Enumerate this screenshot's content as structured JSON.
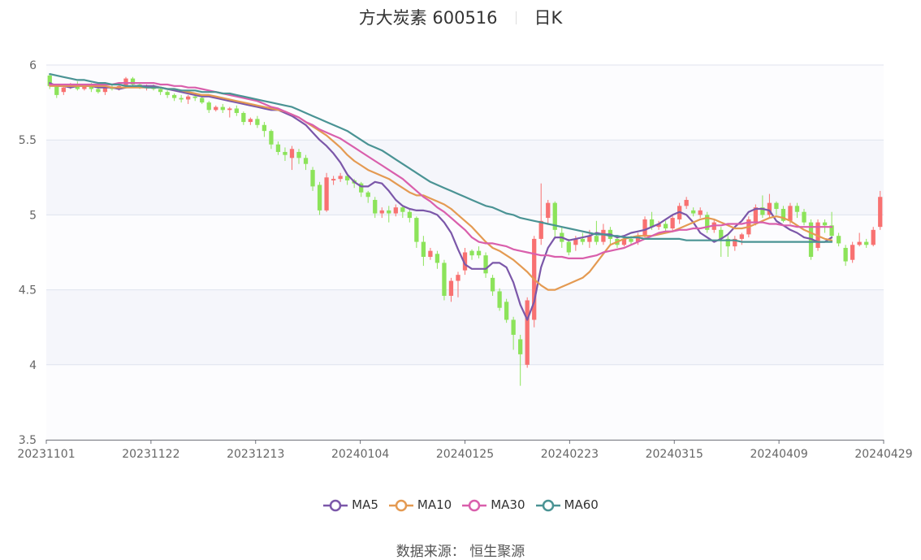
{
  "header": {
    "title": "方大炭素 600516",
    "period": "日K"
  },
  "source_label": "数据来源： 恒生聚源",
  "colors": {
    "up": "#f87171",
    "down": "#8ce35a",
    "grid": "#dfe3ee",
    "band": "#f5f6fb",
    "MA5": "#7b57a9",
    "MA10": "#e49a52",
    "MA30": "#d95fac",
    "MA60": "#4a9394"
  },
  "chart_data": {
    "type": "candlestick",
    "title": "方大炭素 600516",
    "ylim": [
      3.5,
      6
    ],
    "y_ticks": [
      "3.5",
      "4",
      "4.5",
      "5",
      "5.5",
      "6"
    ],
    "x_ticks": [
      "20231101",
      "20231122",
      "20231213",
      "20240104",
      "20240125",
      "20240223",
      "20240315",
      "20240409",
      "20240429"
    ],
    "series": [
      {
        "name": "MA5",
        "values": [
          5.88,
          5.86,
          5.86,
          5.85,
          5.86,
          5.86,
          5.86,
          5.85,
          5.85,
          5.85,
          5.84,
          5.85,
          5.86,
          5.86,
          5.86,
          5.86,
          5.85,
          5.84,
          5.83,
          5.82,
          5.81,
          5.8,
          5.79,
          5.79,
          5.78,
          5.77,
          5.76,
          5.75,
          5.74,
          5.73,
          5.72,
          5.71,
          5.7,
          5.7,
          5.68,
          5.66,
          5.63,
          5.6,
          5.55,
          5.5,
          5.46,
          5.41,
          5.35,
          5.27,
          5.22,
          5.19,
          5.19,
          5.22,
          5.21,
          5.16,
          5.1,
          5.06,
          5.04,
          5.03,
          5.03,
          5.02,
          5.0,
          4.95,
          4.88,
          4.77,
          4.67,
          4.64,
          4.64,
          4.64,
          4.68,
          4.68,
          4.65,
          4.55,
          4.4,
          4.3,
          4.42,
          4.65,
          4.78,
          4.85,
          4.85,
          4.83,
          4.84,
          4.85,
          4.86,
          4.88,
          4.87,
          4.87,
          4.85,
          4.86,
          4.88,
          4.89,
          4.9,
          4.92,
          4.94,
          4.97,
          5.0,
          5.02,
          5.0,
          4.95,
          4.88,
          4.85,
          4.82,
          4.84,
          4.87,
          4.92,
          4.96,
          5.02,
          5.04,
          5.04,
          5.03,
          4.96,
          4.93,
          4.9,
          4.88,
          4.85,
          4.84,
          4.82,
          4.82,
          4.85
        ]
      },
      {
        "name": "MA10",
        "values": [
          5.86,
          5.86,
          5.86,
          5.86,
          5.86,
          5.86,
          5.86,
          5.86,
          5.86,
          5.85,
          5.85,
          5.85,
          5.85,
          5.85,
          5.85,
          5.85,
          5.85,
          5.84,
          5.84,
          5.83,
          5.82,
          5.81,
          5.8,
          5.8,
          5.79,
          5.78,
          5.77,
          5.76,
          5.75,
          5.74,
          5.73,
          5.72,
          5.71,
          5.7,
          5.69,
          5.67,
          5.65,
          5.62,
          5.59,
          5.56,
          5.53,
          5.49,
          5.45,
          5.4,
          5.36,
          5.33,
          5.3,
          5.28,
          5.26,
          5.24,
          5.21,
          5.18,
          5.15,
          5.13,
          5.13,
          5.11,
          5.09,
          5.07,
          5.04,
          5.0,
          4.96,
          4.92,
          4.87,
          4.82,
          4.78,
          4.76,
          4.73,
          4.7,
          4.66,
          4.62,
          4.57,
          4.53,
          4.5,
          4.5,
          4.52,
          4.54,
          4.56,
          4.58,
          4.62,
          4.68,
          4.74,
          4.8,
          4.82,
          4.84,
          4.85,
          4.86,
          4.86,
          4.86,
          4.87,
          4.88,
          4.89,
          4.91,
          4.93,
          4.95,
          4.97,
          4.98,
          4.97,
          4.95,
          4.93,
          4.91,
          4.91,
          4.92,
          4.94,
          4.96,
          4.98,
          4.99,
          4.98,
          4.96,
          4.93,
          4.9,
          4.88,
          4.86,
          4.84,
          4.83
        ]
      },
      {
        "name": "MA30",
        "values": [
          5.87,
          5.87,
          5.87,
          5.87,
          5.87,
          5.87,
          5.87,
          5.87,
          5.87,
          5.87,
          5.88,
          5.88,
          5.88,
          5.88,
          5.88,
          5.88,
          5.87,
          5.87,
          5.86,
          5.86,
          5.85,
          5.85,
          5.84,
          5.83,
          5.82,
          5.81,
          5.8,
          5.79,
          5.78,
          5.77,
          5.76,
          5.74,
          5.72,
          5.71,
          5.69,
          5.67,
          5.65,
          5.62,
          5.6,
          5.57,
          5.55,
          5.53,
          5.51,
          5.48,
          5.45,
          5.42,
          5.39,
          5.36,
          5.33,
          5.3,
          5.27,
          5.24,
          5.2,
          5.16,
          5.12,
          5.09,
          5.05,
          5.02,
          4.98,
          4.94,
          4.9,
          4.85,
          4.82,
          4.81,
          4.81,
          4.8,
          4.79,
          4.77,
          4.76,
          4.75,
          4.74,
          4.73,
          4.73,
          4.72,
          4.72,
          4.71,
          4.71,
          4.71,
          4.72,
          4.73,
          4.75,
          4.76,
          4.77,
          4.78,
          4.8,
          4.82,
          4.84,
          4.86,
          4.88,
          4.89,
          4.89,
          4.9,
          4.9,
          4.91,
          4.91,
          4.92,
          4.93,
          4.93,
          4.94,
          4.94,
          4.94,
          4.95,
          4.95,
          4.95,
          4.94,
          4.94,
          4.93,
          4.93,
          4.92,
          4.92,
          4.92,
          4.92,
          4.92,
          4.92
        ]
      },
      {
        "name": "MA60",
        "values": [
          5.94,
          5.93,
          5.92,
          5.91,
          5.9,
          5.9,
          5.89,
          5.88,
          5.88,
          5.87,
          5.87,
          5.86,
          5.86,
          5.86,
          5.85,
          5.85,
          5.85,
          5.84,
          5.84,
          5.83,
          5.83,
          5.83,
          5.82,
          5.82,
          5.82,
          5.81,
          5.81,
          5.8,
          5.79,
          5.78,
          5.77,
          5.76,
          5.75,
          5.74,
          5.73,
          5.72,
          5.7,
          5.68,
          5.66,
          5.64,
          5.62,
          5.6,
          5.58,
          5.56,
          5.53,
          5.5,
          5.47,
          5.45,
          5.43,
          5.4,
          5.37,
          5.34,
          5.31,
          5.28,
          5.25,
          5.22,
          5.2,
          5.18,
          5.16,
          5.14,
          5.12,
          5.1,
          5.08,
          5.06,
          5.05,
          5.03,
          5.01,
          5.0,
          4.98,
          4.97,
          4.96,
          4.95,
          4.94,
          4.93,
          4.92,
          4.91,
          4.9,
          4.89,
          4.88,
          4.87,
          4.87,
          4.86,
          4.86,
          4.85,
          4.85,
          4.85,
          4.84,
          4.84,
          4.84,
          4.84,
          4.84,
          4.84,
          4.83,
          4.83,
          4.83,
          4.83,
          4.83,
          4.83,
          4.83,
          4.83,
          4.82,
          4.82,
          4.82,
          4.82,
          4.82,
          4.82,
          4.82,
          4.82,
          4.82,
          4.82,
          4.82,
          4.82,
          4.82,
          4.82
        ]
      }
    ],
    "candles": [
      [
        5.93,
        5.86,
        5.94,
        5.84
      ],
      [
        5.86,
        5.8,
        5.87,
        5.78
      ],
      [
        5.82,
        5.85,
        5.86,
        5.8
      ],
      [
        5.85,
        5.87,
        5.88,
        5.84
      ],
      [
        5.87,
        5.84,
        5.89,
        5.83
      ],
      [
        5.84,
        5.86,
        5.87,
        5.83
      ],
      [
        5.86,
        5.84,
        5.88,
        5.82
      ],
      [
        5.84,
        5.82,
        5.85,
        5.81
      ],
      [
        5.82,
        5.85,
        5.86,
        5.8
      ],
      [
        5.85,
        5.84,
        5.87,
        5.83
      ],
      [
        5.84,
        5.86,
        5.88,
        5.83
      ],
      [
        5.86,
        5.91,
        5.92,
        5.85
      ],
      [
        5.91,
        5.87,
        5.92,
        5.85
      ],
      [
        5.87,
        5.85,
        5.88,
        5.84
      ],
      [
        5.85,
        5.86,
        5.87,
        5.83
      ],
      [
        5.86,
        5.84,
        5.87,
        5.83
      ],
      [
        5.84,
        5.82,
        5.85,
        5.8
      ],
      [
        5.82,
        5.8,
        5.83,
        5.78
      ],
      [
        5.8,
        5.78,
        5.81,
        5.76
      ],
      [
        5.78,
        5.77,
        5.8,
        5.75
      ],
      [
        5.77,
        5.79,
        5.8,
        5.74
      ],
      [
        5.79,
        5.78,
        5.8,
        5.76
      ],
      [
        5.78,
        5.75,
        5.79,
        5.74
      ],
      [
        5.75,
        5.7,
        5.76,
        5.68
      ],
      [
        5.7,
        5.72,
        5.73,
        5.69
      ],
      [
        5.72,
        5.7,
        5.74,
        5.68
      ],
      [
        5.7,
        5.71,
        5.72,
        5.65
      ],
      [
        5.71,
        5.68,
        5.73,
        5.66
      ],
      [
        5.68,
        5.62,
        5.69,
        5.6
      ],
      [
        5.62,
        5.64,
        5.65,
        5.6
      ],
      [
        5.64,
        5.6,
        5.66,
        5.58
      ],
      [
        5.6,
        5.56,
        5.62,
        5.52
      ],
      [
        5.56,
        5.47,
        5.57,
        5.44
      ],
      [
        5.47,
        5.42,
        5.49,
        5.4
      ],
      [
        5.42,
        5.4,
        5.45,
        5.36
      ],
      [
        5.38,
        5.44,
        5.46,
        5.3
      ],
      [
        5.42,
        5.38,
        5.44,
        5.34
      ],
      [
        5.38,
        5.34,
        5.4,
        5.3
      ],
      [
        5.3,
        5.19,
        5.32,
        5.16
      ],
      [
        5.2,
        5.03,
        5.22,
        5.0
      ],
      [
        5.03,
        5.25,
        5.28,
        5.02
      ],
      [
        5.23,
        5.24,
        5.26,
        5.2
      ],
      [
        5.24,
        5.26,
        5.28,
        5.22
      ],
      [
        5.26,
        5.23,
        5.28,
        5.2
      ],
      [
        5.23,
        5.21,
        5.24,
        5.18
      ],
      [
        5.21,
        5.15,
        5.22,
        5.12
      ],
      [
        5.15,
        5.12,
        5.16,
        5.08
      ],
      [
        5.1,
        5.01,
        5.12,
        4.98
      ],
      [
        5.01,
        5.03,
        5.05,
        4.98
      ],
      [
        5.03,
        5.01,
        5.06,
        4.95
      ],
      [
        5.01,
        5.05,
        5.07,
        4.99
      ],
      [
        5.05,
        5.02,
        5.06,
        4.98
      ],
      [
        5.02,
        4.98,
        5.04,
        4.95
      ],
      [
        4.98,
        4.82,
        4.99,
        4.78
      ],
      [
        4.82,
        4.72,
        4.86,
        4.66
      ],
      [
        4.72,
        4.76,
        4.78,
        4.7
      ],
      [
        4.74,
        4.68,
        4.76,
        4.64
      ],
      [
        4.68,
        4.46,
        4.7,
        4.43
      ],
      [
        4.46,
        4.56,
        4.58,
        4.42
      ],
      [
        4.56,
        4.6,
        4.62,
        4.45
      ],
      [
        4.63,
        4.75,
        4.78,
        4.6
      ],
      [
        4.76,
        4.73,
        4.77,
        4.7
      ],
      [
        4.76,
        4.73,
        4.79,
        4.71
      ],
      [
        4.73,
        4.61,
        4.75,
        4.58
      ],
      [
        4.58,
        4.49,
        4.6,
        4.46
      ],
      [
        4.49,
        4.38,
        4.51,
        4.36
      ],
      [
        4.42,
        4.3,
        4.44,
        4.28
      ],
      [
        4.3,
        4.2,
        4.32,
        4.1
      ],
      [
        4.17,
        4.07,
        4.2,
        3.86
      ],
      [
        4.0,
        4.43,
        4.45,
        3.98
      ],
      [
        4.3,
        4.84,
        4.86,
        4.25
      ],
      [
        4.84,
        4.96,
        5.21,
        4.8
      ],
      [
        4.98,
        5.08,
        5.1,
        4.94
      ],
      [
        5.08,
        4.9,
        5.09,
        4.84
      ],
      [
        4.88,
        4.82,
        4.92,
        4.78
      ],
      [
        4.82,
        4.75,
        4.84,
        4.73
      ],
      [
        4.8,
        4.84,
        4.86,
        4.76
      ],
      [
        4.84,
        4.82,
        4.88,
        4.8
      ],
      [
        4.82,
        4.86,
        4.9,
        4.78
      ],
      [
        4.86,
        4.82,
        4.96,
        4.8
      ],
      [
        4.82,
        4.9,
        4.94,
        4.8
      ],
      [
        4.9,
        4.84,
        4.92,
        4.8
      ],
      [
        4.84,
        4.8,
        4.86,
        4.78
      ],
      [
        4.8,
        4.84,
        4.86,
        4.79
      ],
      [
        4.84,
        4.82,
        4.86,
        4.8
      ],
      [
        4.82,
        4.86,
        4.88,
        4.8
      ],
      [
        4.86,
        4.97,
        4.99,
        4.84
      ],
      [
        4.97,
        4.92,
        5.02,
        4.9
      ],
      [
        4.92,
        4.94,
        4.96,
        4.9
      ],
      [
        4.94,
        4.91,
        4.96,
        4.89
      ],
      [
        4.91,
        4.98,
        5.0,
        4.89
      ],
      [
        4.97,
        5.06,
        5.08,
        4.94
      ],
      [
        5.06,
        5.1,
        5.12,
        5.04
      ],
      [
        5.03,
        5.01,
        5.05,
        4.99
      ],
      [
        5.0,
        5.03,
        5.05,
        4.98
      ],
      [
        5.0,
        4.9,
        5.02,
        4.88
      ],
      [
        4.9,
        4.95,
        4.97,
        4.88
      ],
      [
        4.9,
        4.84,
        4.92,
        4.72
      ],
      [
        4.84,
        4.79,
        4.86,
        4.72
      ],
      [
        4.79,
        4.84,
        4.86,
        4.76
      ],
      [
        4.84,
        4.87,
        4.88,
        4.8
      ],
      [
        4.87,
        4.97,
        4.99,
        4.85
      ],
      [
        4.95,
        5.05,
        5.07,
        4.93
      ],
      [
        5.05,
        5.0,
        5.13,
        4.98
      ],
      [
        5.0,
        5.08,
        5.14,
        4.98
      ],
      [
        5.08,
        5.04,
        5.09,
        5.0
      ],
      [
        5.04,
        4.96,
        5.06,
        4.95
      ],
      [
        4.96,
        5.06,
        5.08,
        4.94
      ],
      [
        5.06,
        5.02,
        5.08,
        4.98
      ],
      [
        5.02,
        4.95,
        5.04,
        4.93
      ],
      [
        4.95,
        4.72,
        4.97,
        4.7
      ],
      [
        4.78,
        4.95,
        4.97,
        4.76
      ],
      [
        4.95,
        4.93,
        4.97,
        4.88
      ],
      [
        4.93,
        4.86,
        5.02,
        4.84
      ],
      [
        4.86,
        4.81,
        4.88,
        4.79
      ],
      [
        4.78,
        4.69,
        4.8,
        4.66
      ],
      [
        4.7,
        4.8,
        4.82,
        4.68
      ],
      [
        4.8,
        4.82,
        4.88,
        4.79
      ],
      [
        4.82,
        4.8,
        4.84,
        4.78
      ],
      [
        4.8,
        4.9,
        4.92,
        4.79
      ],
      [
        4.92,
        5.12,
        5.16,
        4.9
      ]
    ]
  }
}
